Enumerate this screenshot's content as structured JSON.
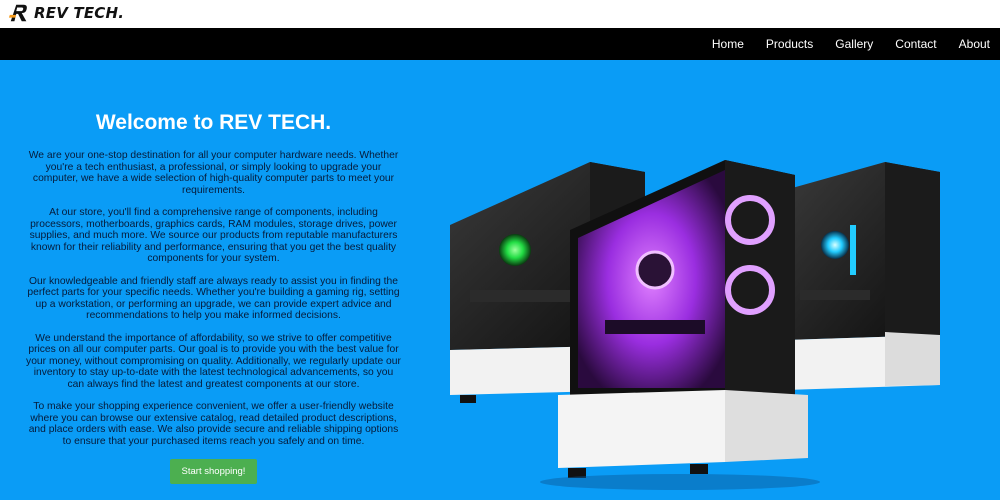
{
  "brand": {
    "name": "REV TECH."
  },
  "nav": {
    "items": [
      "Home",
      "Products",
      "Gallery",
      "Contact",
      "About"
    ]
  },
  "hero": {
    "title": "Welcome to REV TECH.",
    "paragraphs": [
      "We are your one-stop destination for all your computer hardware needs. Whether you're a tech enthusiast, a professional, or simply looking to upgrade your computer, we have a wide selection of high-quality computer parts to meet your requirements.",
      "At our store, you'll find a comprehensive range of components, including processors, motherboards, graphics cards, RAM modules, storage drives, power supplies, and much more. We source our products from reputable manufacturers known for their reliability and performance, ensuring that you get the best quality components for your system.",
      "Our knowledgeable and friendly staff are always ready to assist you in finding the perfect parts for your specific needs. Whether you're building a gaming rig, setting up a workstation, or performing an upgrade, we can provide expert advice and recommendations to help you make informed decisions.",
      "We understand the importance of affordability, so we strive to offer competitive prices on all our computer parts. Our goal is to provide you with the best value for your money, without compromising on quality. Additionally, we regularly update our inventory to stay up-to-date with the latest technological advancements, so you can always find the latest and greatest components at our store.",
      "To make your shopping experience convenient, we offer a user-friendly website where you can browse our extensive catalog, read detailed product descriptions, and place orders with ease. We also provide secure and reliable shipping options to ensure that your purchased items reach you safely and on time."
    ],
    "cta_label": "Start shopping!"
  },
  "colors": {
    "page_bg": "#0a9cf6",
    "navbar_bg": "#000000",
    "cta_bg": "#4caf50",
    "case_top": "#151515",
    "case_bottom": "#f2f2f2",
    "rgb_purple": "#b040ff",
    "rgb_green": "#22dd44",
    "rgb_cyan": "#22ccff"
  },
  "icons": {
    "logo": "rev-tech-logo-icon"
  }
}
